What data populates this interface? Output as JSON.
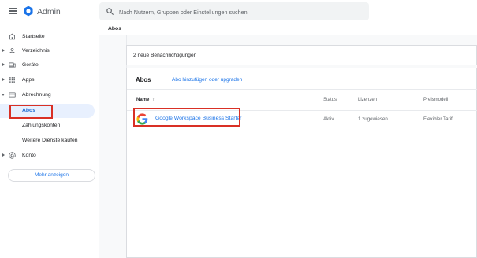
{
  "app": {
    "title": "Admin"
  },
  "search": {
    "placeholder": "Nach Nutzern, Gruppen oder Einstellungen suchen"
  },
  "breadcrumb": {
    "current": "Abos"
  },
  "sidebar": {
    "items": [
      {
        "label": "Startseite",
        "icon": "home-icon"
      },
      {
        "label": "Verzeichnis",
        "icon": "person-icon"
      },
      {
        "label": "Geräte",
        "icon": "devices-icon"
      },
      {
        "label": "Apps",
        "icon": "apps-grid-icon"
      },
      {
        "label": "Abrechnung",
        "icon": "billing-icon"
      },
      {
        "label": "Abos",
        "active": true
      },
      {
        "label": "Zahlungskonten"
      },
      {
        "label": "Weitere Dienste kaufen"
      },
      {
        "label": "Konto",
        "icon": "at-icon"
      }
    ],
    "more_label": "Mehr anzeigen"
  },
  "notifications": {
    "text": "2 neue Benachrichtigungen"
  },
  "subscriptions": {
    "title": "Abos",
    "add_link": "Abo hinzufügen oder upgraden",
    "columns": {
      "name": "Name",
      "sort": "↑",
      "status": "Status",
      "licenses": "Lizenzen",
      "pricing": "Preismodell"
    },
    "rows": [
      {
        "name": "Google Workspace Business Starter",
        "status": "Aktiv",
        "licenses": "1 zugewiesen",
        "pricing": "Flexibler Tarif"
      }
    ]
  },
  "colors": {
    "accent": "#1a73e8",
    "highlight": "#d93025",
    "active_bg": "#e8f0fe"
  }
}
